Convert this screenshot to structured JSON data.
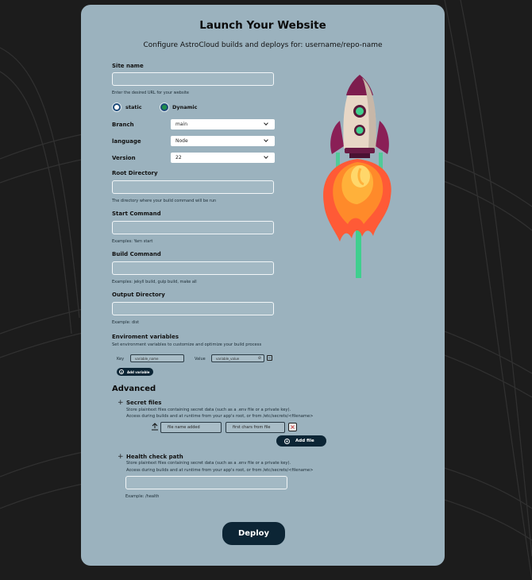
{
  "header": {
    "title": "Launch Your Website",
    "subtitle": "Configure AstroCloud builds and deploys for: username/repo-name"
  },
  "form": {
    "site_name": {
      "label": "Site name",
      "value": "",
      "hint": "Enter the desired URL for your website"
    },
    "runtime_type": {
      "options": [
        {
          "label": "static",
          "selected": true,
          "dot_color": "#ffffff"
        },
        {
          "label": "Dynamic",
          "selected": false,
          "dot_color": "#1f8f4a"
        }
      ]
    },
    "branch": {
      "label": "Branch",
      "value": "main"
    },
    "language": {
      "label": "language",
      "value": "Node"
    },
    "version": {
      "label": "Version",
      "value": "22"
    },
    "root_directory": {
      "label": "Root Directory",
      "value": "",
      "hint": "The directory where your build command will be run"
    },
    "start_command": {
      "label": "Start Command",
      "value": "",
      "hint": "Examples: Yarn start"
    },
    "build_command": {
      "label": "Build Command",
      "value": "",
      "hint": "Examples: jekyll build, gulp build, make all"
    },
    "output_directory": {
      "label": "Output Directory",
      "value": "",
      "hint": "Example: dist"
    },
    "env_vars": {
      "title": "Enviroment variables",
      "description": "Set environment variables to customize and optimize your build process",
      "key_label": "Key",
      "key_value": "variable_name",
      "value_label": "Value",
      "value_value": "variable_value",
      "add_label": "Add variable"
    },
    "advanced": {
      "title": "Advanced",
      "secret_files": {
        "title": "Secret files",
        "desc_line1": "Store plaintext files containing secret data (such as a .env file or a private key).",
        "desc_line2": "Access during builds and at runtime from your app's root, or from /etc/secrets/<filename>",
        "file_name": "file name added",
        "file_preview": "first chars from file",
        "add_label": "Add file"
      },
      "health_check": {
        "title": "Health check path",
        "desc_line1": "Store plaintext files containing secret data (such as a .env file or a private key).",
        "desc_line2": "Access during builds and at runtime from your app's root, or from /etc/secrets/<filename>",
        "value": "",
        "hint": "Example: /health"
      }
    },
    "deploy_label": "Deploy"
  },
  "colors": {
    "card": "#9bb2be",
    "primary_button": "#0c2535",
    "background": "#1c1c1c"
  }
}
